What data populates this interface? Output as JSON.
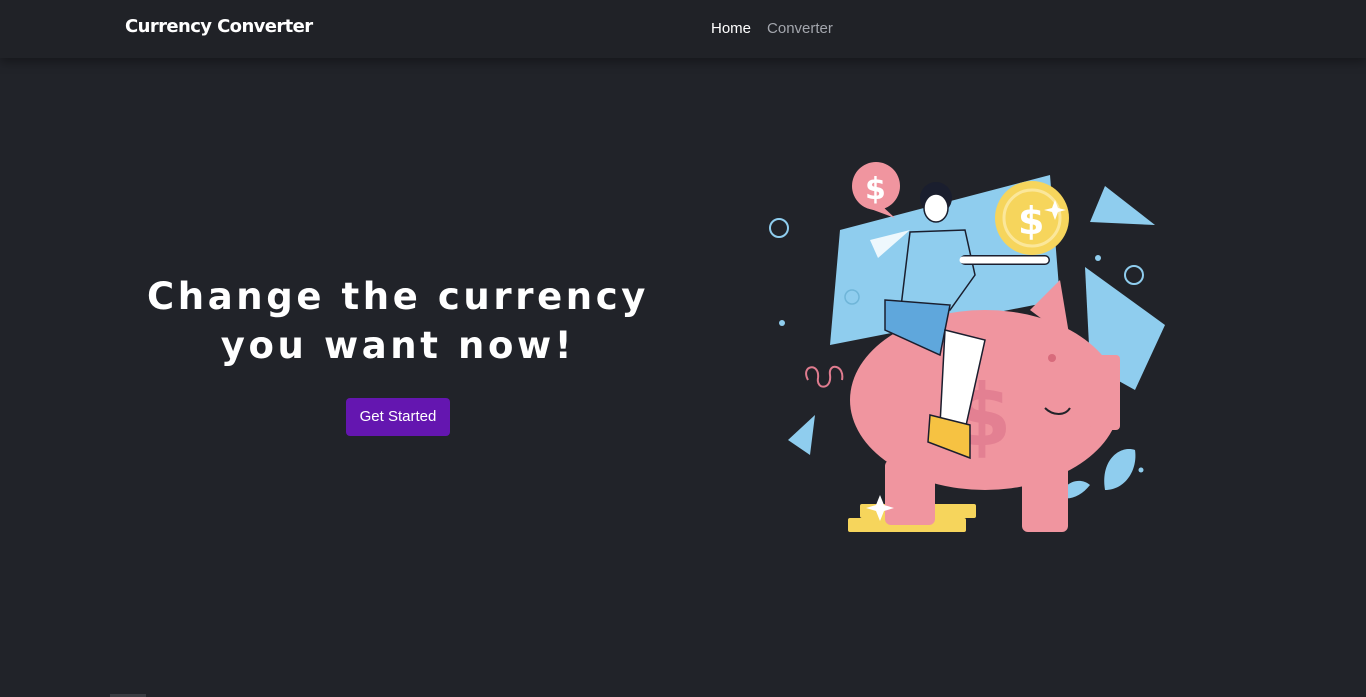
{
  "navbar": {
    "brand": "Currency Converter",
    "links": [
      {
        "label": "Home",
        "active": true
      },
      {
        "label": "Converter",
        "active": false
      }
    ]
  },
  "hero": {
    "headline_line1": "Change the currency",
    "headline_line2": "you want now!",
    "cta_label": "Get Started"
  },
  "illustration": {
    "description_icon": "piggy-bank-illustration-icon",
    "currency_symbol": "$"
  },
  "colors": {
    "background": "#212329",
    "navbar": "#202227",
    "accent_button": "#6416b0",
    "pig_pink": "#f0959f",
    "coin_yellow": "#f6d55c",
    "shape_blue": "#8fcdee"
  }
}
